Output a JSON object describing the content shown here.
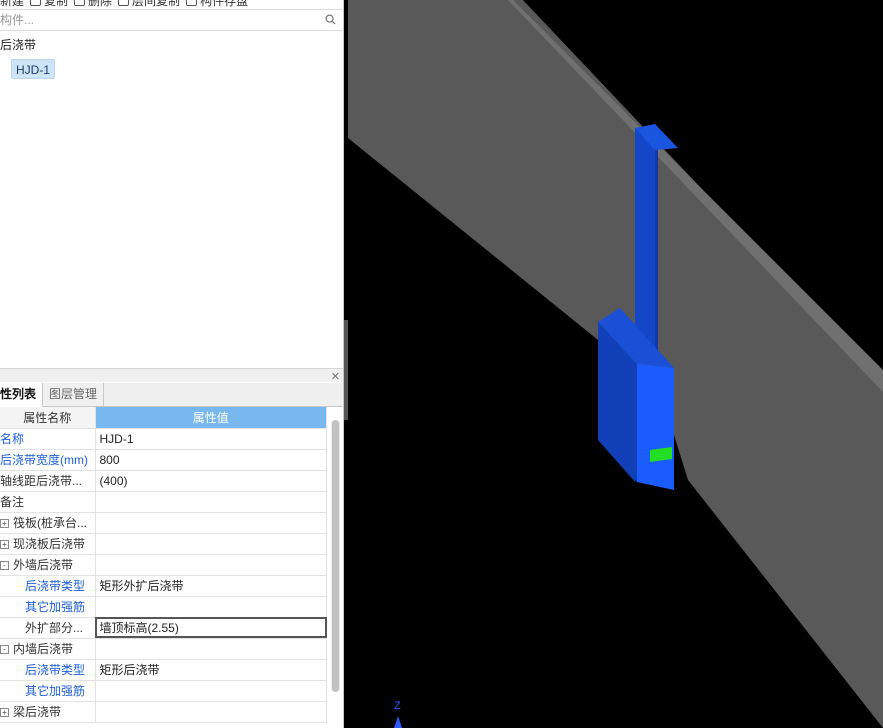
{
  "toolbar": {
    "new_label": "新建",
    "copy_label": "复制",
    "delete_label": "删除",
    "layer_copy_label": "层间复制",
    "store_label": "构件存盘"
  },
  "search": {
    "placeholder": "构件..."
  },
  "tree": {
    "group_label": "后浇带",
    "items": [
      {
        "label": "HJD-1"
      }
    ]
  },
  "tabs": [
    {
      "label": "性列表",
      "active": true
    },
    {
      "label": "图层管理",
      "active": false
    }
  ],
  "table": {
    "headers": {
      "name": "属性名称",
      "value": "属性值"
    },
    "rows": [
      {
        "name": "名称",
        "value": "HJD-1",
        "blue": true
      },
      {
        "name": "后浇带宽度(mm)",
        "value": "800",
        "blue": true
      },
      {
        "name": "轴线距后浇带...",
        "value": "(400)",
        "blue": false
      },
      {
        "name": "备注",
        "value": "",
        "blue": false
      },
      {
        "name": "筏板(桩承台...",
        "value": "",
        "expander": "+"
      },
      {
        "name": "现浇板后浇带",
        "value": "",
        "expander": "+"
      },
      {
        "name": "外墙后浇带",
        "value": "",
        "expander": "-"
      },
      {
        "name": "后浇带类型",
        "value": "矩形外扩后浇带",
        "blue": true,
        "indent": true
      },
      {
        "name": "其它加强筋",
        "value": "",
        "blue": true,
        "indent": true
      },
      {
        "name": "外扩部分...",
        "value": "墙顶标高(2.55)",
        "indent": true,
        "selected": true
      },
      {
        "name": "内墙后浇带",
        "value": "",
        "expander": "-"
      },
      {
        "name": "后浇带类型",
        "value": "矩形后浇带",
        "blue": true,
        "indent": true
      },
      {
        "name": "其它加强筋",
        "value": "",
        "blue": true,
        "indent": true
      },
      {
        "name": "梁后浇带",
        "value": "",
        "expander": "+"
      }
    ]
  },
  "viewport": {
    "axis_label": "Z",
    "colors": {
      "background": "#000000",
      "wall": "#595959",
      "post_band": "#1a5cff",
      "marker": "#22dd22"
    }
  }
}
